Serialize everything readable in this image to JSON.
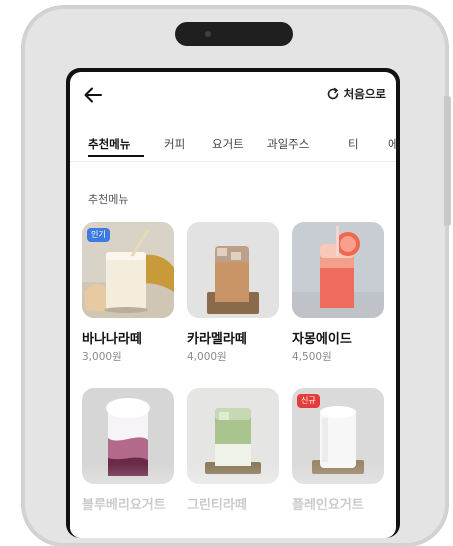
{
  "header": {
    "back_icon": "arrow-left-icon",
    "restart_icon": "refresh-icon",
    "restart_label": "처음으로"
  },
  "tabs": [
    {
      "label": "추천메뉴",
      "active": true
    },
    {
      "label": "커피",
      "active": false
    },
    {
      "label": "요거트",
      "active": false
    },
    {
      "label": "과일주스",
      "active": false
    },
    {
      "label": "티",
      "active": false
    },
    {
      "label": "에",
      "active": false
    }
  ],
  "section": {
    "title": "추천메뉴"
  },
  "menu_items": [
    {
      "name": "바나나라떼",
      "price": "3,000원",
      "badge": "인기",
      "badge_color": "#3d7be0"
    },
    {
      "name": "카라멜라떼",
      "price": "4,000원",
      "badge": "",
      "badge_color": ""
    },
    {
      "name": "자몽에이드",
      "price": "4,500원",
      "badge": "",
      "badge_color": ""
    },
    {
      "name": "블루베리요거트",
      "price": "",
      "badge": "",
      "badge_color": ""
    },
    {
      "name": "그린티라떼",
      "price": "",
      "badge": "",
      "badge_color": ""
    },
    {
      "name": "플레인요거트",
      "price": "",
      "badge": "신규",
      "badge_color": "#e53b3b"
    }
  ],
  "colors": {
    "popular_badge": "#3d7be0",
    "new_badge": "#e53b3b",
    "text_primary": "#111111",
    "text_secondary": "#8a8a8a"
  }
}
